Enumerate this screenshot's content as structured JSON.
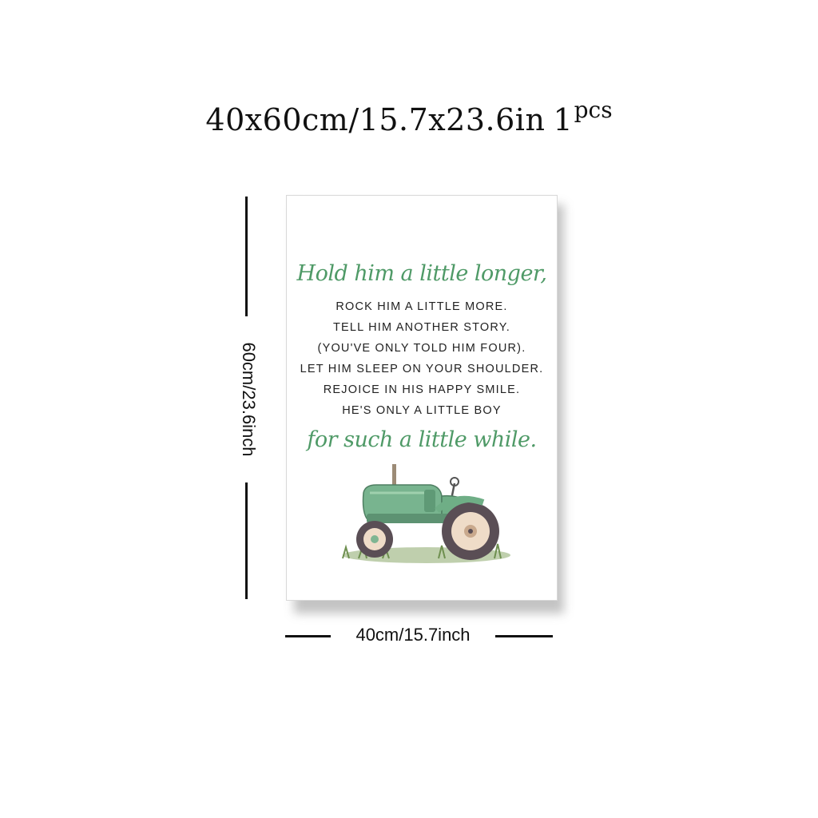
{
  "headline": {
    "size_text": "40x60cm/15.7x23.6in",
    "qty_number": "1",
    "qty_unit": "pcs"
  },
  "poster": {
    "script_first": "Hold him a little longer,",
    "verse": [
      "ROCK HIM A LITTLE MORE.",
      "TELL HIM ANOTHER STORY.",
      "(YOU'VE ONLY TOLD HIM FOUR).",
      "LET HIM SLEEP ON YOUR SHOULDER.",
      "REJOICE IN HIS HAPPY SMILE.",
      "HE'S ONLY A LITTLE BOY"
    ],
    "script_last": "for such a little while.",
    "illustration": "tractor-illustration",
    "colors": {
      "script": "#4f9a67",
      "tractor": "#6fae86"
    }
  },
  "dimensions": {
    "height_label": "60cm/23.6inch",
    "width_label": "40cm/15.7inch"
  }
}
